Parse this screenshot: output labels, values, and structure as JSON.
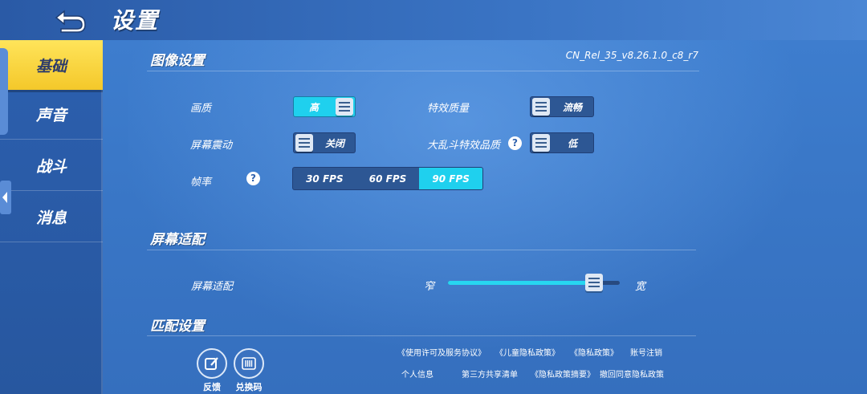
{
  "header": {
    "title": "设置"
  },
  "sidebar": {
    "items": [
      {
        "label": "基础",
        "active": true
      },
      {
        "label": "声音",
        "active": false
      },
      {
        "label": "战斗",
        "active": false
      },
      {
        "label": "消息",
        "active": false
      }
    ]
  },
  "graphics": {
    "title": "图像设置",
    "version": "CN_Rel_35_v8.26.1.0_c8_r7",
    "quality": {
      "label": "画质",
      "value": "高"
    },
    "effects_quality": {
      "label": "特效质量",
      "value": "流畅"
    },
    "screen_shake": {
      "label": "屏幕震动",
      "value": "关闭"
    },
    "brawl_effects": {
      "label": "大乱斗特效品质",
      "help": "?",
      "value": "低"
    },
    "framerate": {
      "label": "帧率",
      "help": "?",
      "options": [
        "30 FPS",
        "60 FPS",
        "90 FPS"
      ],
      "selected": "90 FPS"
    }
  },
  "screen_fit": {
    "title": "屏幕适配",
    "label": "屏幕适配",
    "min_label": "窄",
    "max_label": "宽",
    "value_fraction": 0.85
  },
  "matching": {
    "title": "匹配设置"
  },
  "footer": {
    "feedback_label": "反馈",
    "redeem_label": "兑换码",
    "links_row1": [
      "《使用许可及服务协议》",
      "《儿童隐私政策》",
      "《隐私政策》",
      "账号注销"
    ],
    "links_row2": [
      "个人信息",
      "第三方共享清单",
      "《隐私政策摘要》",
      "撤回同意隐私政策"
    ]
  },
  "colors": {
    "accent_active": "#1fd0ee",
    "sidebar_active": "#f4c82a",
    "background": "#3a78c8"
  }
}
